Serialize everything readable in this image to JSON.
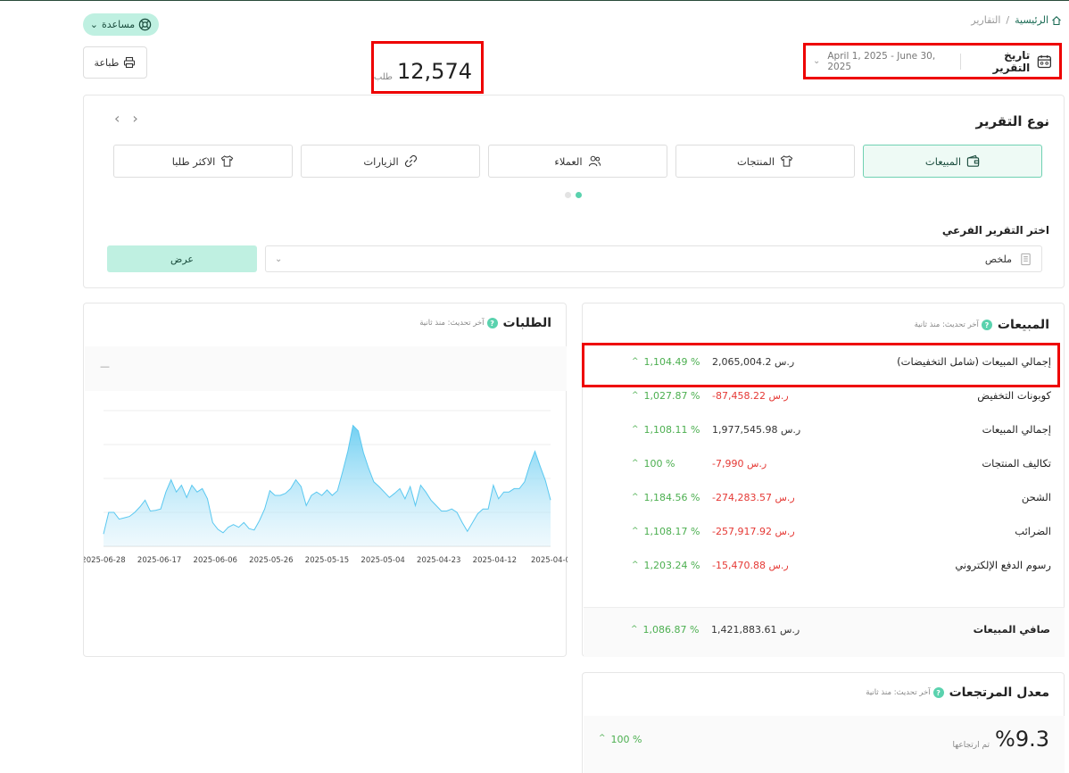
{
  "header": {
    "help_label": "مساعدة",
    "breadcrumb": {
      "home": "الرئيسية",
      "separator": "/",
      "current": "التقارير"
    },
    "print_label": "طباعة",
    "date": {
      "label": "تاريخ التقرير",
      "range": "April 1, 2025 - June 30, 2025"
    }
  },
  "report_type": {
    "title": "نوع التقرير",
    "tabs": [
      {
        "label": "المبيعات",
        "icon": "wallet-icon",
        "active": true
      },
      {
        "label": "المنتجات",
        "icon": "shirt-icon"
      },
      {
        "label": "العملاء",
        "icon": "users-icon"
      },
      {
        "label": "الزيارات",
        "icon": "link-icon"
      },
      {
        "label": "الاكثر طلبا",
        "icon": "shirt-icon"
      }
    ],
    "sub_label": "اختر التقرير الفرعي",
    "sub_value": "ملخص",
    "show_label": "عرض"
  },
  "orders": {
    "title": "الطلبات",
    "updated": "آخر تحديث: منذ ثانية",
    "value": "12,574",
    "unit": "طلب",
    "dash": "—"
  },
  "chart_data": {
    "type": "area",
    "x_ticks": [
      "2025-06-28",
      "2025-06-17",
      "2025-06-06",
      "2025-05-26",
      "2025-05-15",
      "2025-05-04",
      "2025-04-23",
      "2025-04-12",
      "2025-04-0"
    ],
    "values": [
      98,
      130,
      130,
      120,
      122,
      124,
      130,
      138,
      148,
      132,
      133,
      135,
      160,
      178,
      160,
      170,
      152,
      170,
      160,
      165,
      150,
      115,
      105,
      100,
      108,
      112,
      108,
      115,
      106,
      104,
      118,
      135,
      162,
      155,
      155,
      158,
      165,
      178,
      168,
      140,
      155,
      160,
      155,
      163,
      155,
      162,
      190,
      220,
      258,
      250,
      218,
      195,
      175,
      168,
      160,
      152,
      158,
      165,
      150,
      168,
      140,
      170,
      160,
      148,
      140,
      132,
      132,
      135,
      130,
      115,
      102,
      115,
      128,
      135,
      135,
      170,
      150,
      160,
      160,
      165,
      165,
      175,
      200,
      220,
      198,
      177,
      148
    ],
    "ylim": [
      80,
      280
    ],
    "color": "#5ac8f0"
  },
  "sales": {
    "title": "المبيعات",
    "updated": "آخر تحديث: منذ ثانية",
    "rows": [
      {
        "name": "إجمالي المبيعات (شامل التخفيضات)",
        "value": "2,065,004.2 ر.س",
        "negative": false,
        "pct": "1,104.49 %"
      },
      {
        "name": "كوبونات التخفيض",
        "value": "-87,458.22 ر.س",
        "negative": true,
        "pct": "1,027.87 %"
      },
      {
        "name": "إجمالي المبيعات",
        "value": "1,977,545.98 ر.س",
        "negative": false,
        "pct": "1,108.11 %"
      },
      {
        "name": "تكاليف المنتجات",
        "value": "-7,990 ر.س",
        "negative": true,
        "pct": "100 %"
      },
      {
        "name": "الشحن",
        "value": "-274,283.57 ر.س",
        "negative": true,
        "pct": "1,184.56 %"
      },
      {
        "name": "الضرائب",
        "value": "-257,917.92 ر.س",
        "negative": true,
        "pct": "1,108.17 %"
      },
      {
        "name": "رسوم الدفع الإلكتروني",
        "value": "-15,470.88 ر.س",
        "negative": true,
        "pct": "1,203.24 %"
      }
    ],
    "net": {
      "name": "صافي المبيعات",
      "value": "1,421,883.61 ر.س",
      "pct": "1,086.87 %"
    }
  },
  "returns": {
    "title": "معدل المرتجعات",
    "updated": "آخر تحديث: منذ ثانية",
    "value": "%9.3",
    "unit": "تم ارتجاعها",
    "pct": "100 %"
  }
}
